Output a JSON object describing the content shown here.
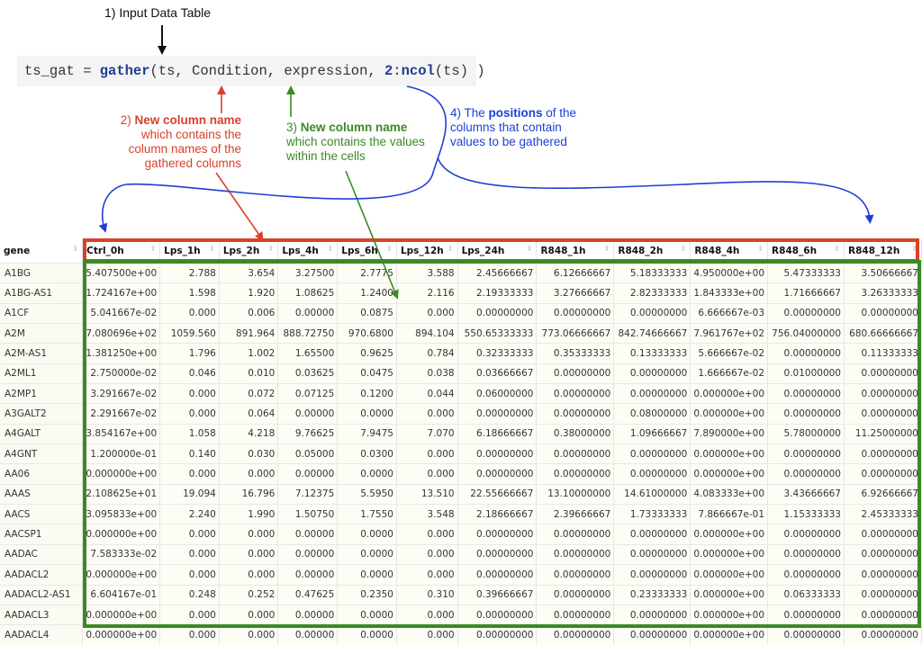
{
  "step1": "1) Input Data Table",
  "code": {
    "var": "ts_gat",
    "op": " = ",
    "fn": "gather",
    "args_open": "(ts, Condition, expression, ",
    "num": "2",
    "colon": ":",
    "ncol": "ncol",
    "args_close": "(ts) )"
  },
  "ann2": {
    "prefix": "2) ",
    "bold": "New column name",
    "line2": "which contains the",
    "line3": "column names of the",
    "line4": "gathered columns"
  },
  "ann3": {
    "prefix": "3) ",
    "bold": "New column name",
    "line2": "which contains the values",
    "line3": "within the cells"
  },
  "ann4": {
    "prefix": "4) The ",
    "bold": "positions",
    "suffix": " of the",
    "line2": "columns that contain",
    "line3": "values to be gathered"
  },
  "colors": {
    "red": "#d8412a",
    "green": "#3a8a25",
    "blue": "#1d3fd6"
  },
  "table": {
    "headers": [
      "gene",
      "Ctrl_0h",
      "Lps_1h",
      "Lps_2h",
      "Lps_4h",
      "Lps_6h",
      "Lps_12h",
      "Lps_24h",
      "R848_1h",
      "R848_2h",
      "R848_4h",
      "R848_6h",
      "R848_12h"
    ],
    "rows": [
      [
        "A1BG",
        "5.407500e+00",
        "2.788",
        "3.654",
        "3.27500",
        "2.7775",
        "3.588",
        "2.45666667",
        "6.12666667",
        "5.18333333",
        "4.950000e+00",
        "5.47333333",
        "3.50666667"
      ],
      [
        "A1BG-AS1",
        "1.724167e+00",
        "1.598",
        "1.920",
        "1.08625",
        "1.2400",
        "2.116",
        "2.19333333",
        "3.27666667",
        "2.82333333",
        "1.843333e+00",
        "1.71666667",
        "3.26333333"
      ],
      [
        "A1CF",
        "5.041667e-02",
        "0.000",
        "0.006",
        "0.00000",
        "0.0875",
        "0.000",
        "0.00000000",
        "0.00000000",
        "0.00000000",
        "6.666667e-03",
        "0.00000000",
        "0.00000000"
      ],
      [
        "A2M",
        "7.080696e+02",
        "1059.560",
        "891.964",
        "888.72750",
        "970.6800",
        "894.104",
        "550.65333333",
        "773.06666667",
        "842.74666667",
        "7.961767e+02",
        "756.04000000",
        "680.66666667"
      ],
      [
        "A2M-AS1",
        "1.381250e+00",
        "1.796",
        "1.002",
        "1.65500",
        "0.9625",
        "0.784",
        "0.32333333",
        "0.35333333",
        "0.13333333",
        "5.666667e-02",
        "0.00000000",
        "0.11333333"
      ],
      [
        "A2ML1",
        "2.750000e-02",
        "0.046",
        "0.010",
        "0.03625",
        "0.0475",
        "0.038",
        "0.03666667",
        "0.00000000",
        "0.00000000",
        "1.666667e-02",
        "0.01000000",
        "0.00000000"
      ],
      [
        "A2MP1",
        "3.291667e-02",
        "0.000",
        "0.072",
        "0.07125",
        "0.1200",
        "0.044",
        "0.06000000",
        "0.00000000",
        "0.00000000",
        "0.000000e+00",
        "0.00000000",
        "0.00000000"
      ],
      [
        "A3GALT2",
        "2.291667e-02",
        "0.000",
        "0.064",
        "0.00000",
        "0.0000",
        "0.000",
        "0.00000000",
        "0.00000000",
        "0.08000000",
        "0.000000e+00",
        "0.00000000",
        "0.00000000"
      ],
      [
        "A4GALT",
        "3.854167e+00",
        "1.058",
        "4.218",
        "9.76625",
        "7.9475",
        "7.070",
        "6.18666667",
        "0.38000000",
        "1.09666667",
        "7.890000e+00",
        "5.78000000",
        "11.25000000"
      ],
      [
        "A4GNT",
        "1.200000e-01",
        "0.140",
        "0.030",
        "0.05000",
        "0.0300",
        "0.000",
        "0.00000000",
        "0.00000000",
        "0.00000000",
        "0.000000e+00",
        "0.00000000",
        "0.00000000"
      ],
      [
        "AA06",
        "0.000000e+00",
        "0.000",
        "0.000",
        "0.00000",
        "0.0000",
        "0.000",
        "0.00000000",
        "0.00000000",
        "0.00000000",
        "0.000000e+00",
        "0.00000000",
        "0.00000000"
      ],
      [
        "AAAS",
        "2.108625e+01",
        "19.094",
        "16.796",
        "7.12375",
        "5.5950",
        "13.510",
        "22.55666667",
        "13.10000000",
        "14.61000000",
        "4.083333e+00",
        "3.43666667",
        "6.92666667"
      ],
      [
        "AACS",
        "3.095833e+00",
        "2.240",
        "1.990",
        "1.50750",
        "1.7550",
        "3.548",
        "2.18666667",
        "2.39666667",
        "1.73333333",
        "7.866667e-01",
        "1.15333333",
        "2.45333333"
      ],
      [
        "AACSP1",
        "0.000000e+00",
        "0.000",
        "0.000",
        "0.00000",
        "0.0000",
        "0.000",
        "0.00000000",
        "0.00000000",
        "0.00000000",
        "0.000000e+00",
        "0.00000000",
        "0.00000000"
      ],
      [
        "AADAC",
        "7.583333e-02",
        "0.000",
        "0.000",
        "0.00000",
        "0.0000",
        "0.000",
        "0.00000000",
        "0.00000000",
        "0.00000000",
        "0.000000e+00",
        "0.00000000",
        "0.00000000"
      ],
      [
        "AADACL2",
        "0.000000e+00",
        "0.000",
        "0.000",
        "0.00000",
        "0.0000",
        "0.000",
        "0.00000000",
        "0.00000000",
        "0.00000000",
        "0.000000e+00",
        "0.00000000",
        "0.00000000"
      ],
      [
        "AADACL2-AS1",
        "6.604167e-01",
        "0.248",
        "0.252",
        "0.47625",
        "0.2350",
        "0.310",
        "0.39666667",
        "0.00000000",
        "0.23333333",
        "0.000000e+00",
        "0.06333333",
        "0.00000000"
      ],
      [
        "AADACL3",
        "0.000000e+00",
        "0.000",
        "0.000",
        "0.00000",
        "0.0000",
        "0.000",
        "0.00000000",
        "0.00000000",
        "0.00000000",
        "0.000000e+00",
        "0.00000000",
        "0.00000000"
      ],
      [
        "AADACL4",
        "0.000000e+00",
        "0.000",
        "0.000",
        "0.00000",
        "0.0000",
        "0.000",
        "0.00000000",
        "0.00000000",
        "0.00000000",
        "0.000000e+00",
        "0.00000000",
        "0.00000000"
      ]
    ]
  }
}
